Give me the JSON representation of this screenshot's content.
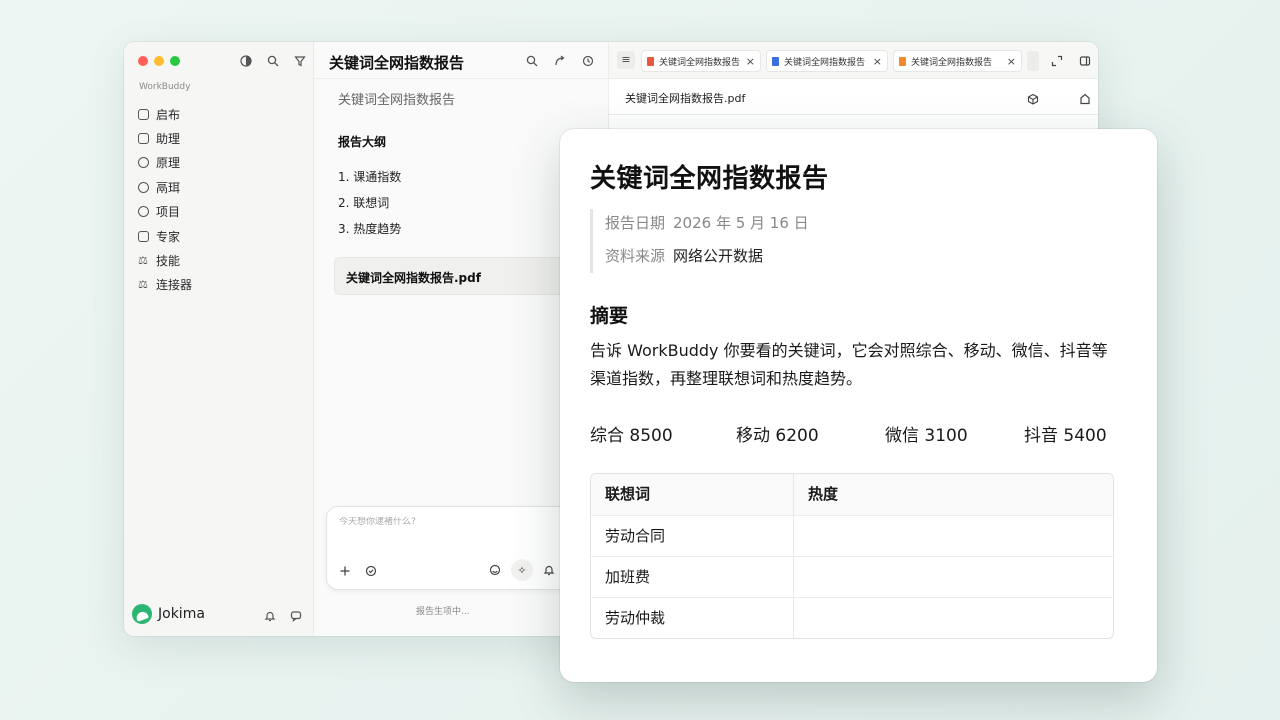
{
  "app": {
    "brand": "WorkBuddy"
  },
  "sidebar": {
    "items": [
      {
        "label": "启布"
      },
      {
        "label": "助理"
      },
      {
        "label": "原理"
      },
      {
        "label": "鬲珥"
      },
      {
        "label": "项目"
      },
      {
        "label": "专家"
      },
      {
        "label": "技能"
      },
      {
        "label": "连接器"
      }
    ],
    "user": "Jokima"
  },
  "middle": {
    "title": "关键词全网指数报告",
    "subtitle": "关键词全网指数报告",
    "outline_heading": "报告大纲",
    "outline": [
      "1.  课通指数",
      "2.  联想词",
      "3.  热度趋势"
    ],
    "file_card": "关键词全网指数报告.pdf",
    "chat_placeholder": "今天想你逮褚什么?",
    "status": "报告生项中..."
  },
  "right": {
    "tabs": [
      {
        "label": "关键词全网指数报告",
        "color": "#e8573f"
      },
      {
        "label": "关键词全网指数报告",
        "color": "#3b6fe0"
      },
      {
        "label": "关键词全网指数报告",
        "color": "#f08a2c"
      }
    ],
    "doc_file": "关键词全网指数报告.pdf"
  },
  "document": {
    "title": "关键词全网指数报告",
    "meta": {
      "date_label": "报告日期",
      "date_value": "2026 年 5 月 16 日",
      "source_label": "资料来源",
      "source_value": "网络公开数据"
    },
    "summary_heading": "摘要",
    "summary": "告诉 WorkBuddy 你要看的关键词，它会对照综合、移动、微信、抖音等渠道指数，再整理联想词和热度趋势。",
    "stats": [
      {
        "text": "综合  8500"
      },
      {
        "text": "移动  6200"
      },
      {
        "text": "微信  3100"
      },
      {
        "text": "抖音  5400"
      }
    ],
    "table": {
      "headers": [
        "联想词",
        "热度"
      ],
      "rows": [
        [
          "劳动合同",
          ""
        ],
        [
          "加班费",
          ""
        ],
        [
          "劳动仲裁",
          ""
        ]
      ]
    }
  }
}
